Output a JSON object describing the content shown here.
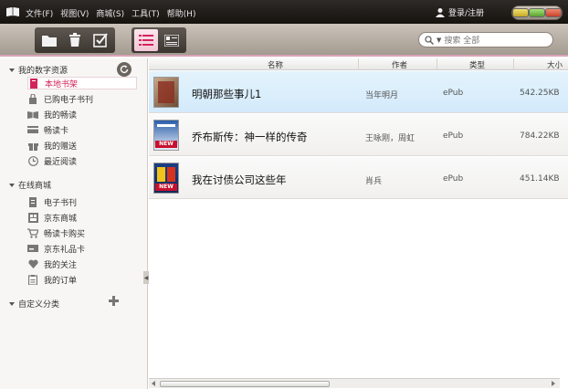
{
  "menu": [
    "文件(F)",
    "视图(V)",
    "商城(S)",
    "工具(T)",
    "帮助(H)"
  ],
  "login_label": "登录/注册",
  "search": {
    "placeholder": "搜索 全部"
  },
  "sidebar": {
    "sections": [
      {
        "label": "我的数字资源",
        "items": [
          "本地书架",
          "已购电子书刊",
          "我的畅读",
          "畅读卡",
          "我的赠送",
          "最近阅读"
        ]
      },
      {
        "label": "在线商城",
        "items": [
          "电子书刊",
          "京东商城",
          "畅读卡购买",
          "京东礼品卡",
          "我的关注",
          "我的订单"
        ]
      },
      {
        "label": "自定义分类",
        "items": []
      }
    ],
    "selected": "本地书架"
  },
  "table": {
    "columns": [
      "名称",
      "作者",
      "类型",
      "大小"
    ],
    "rows": [
      {
        "title": "明朝那些事儿1",
        "author": "当年明月",
        "type": "ePub",
        "size": "542.25KB",
        "cover_badge": ""
      },
      {
        "title": "乔布斯传：神一样的传奇",
        "author": "王咏刚，周虹",
        "type": "ePub",
        "size": "784.22KB",
        "cover_badge": "NEW"
      },
      {
        "title": "我在讨债公司这些年",
        "author": "肖兵",
        "type": "ePub",
        "size": "451.14KB",
        "cover_badge": "NEW"
      }
    ]
  },
  "colors": {
    "accent": "#d2245a",
    "selected_row": "#d9edfb",
    "titlebar": "#1e1a17"
  },
  "icons": [
    "book-logo-icon",
    "folder-icon",
    "trash-icon",
    "checkbox-icon",
    "list-view-icon",
    "shelf-view-icon",
    "search-icon",
    "user-icon",
    "refresh-icon",
    "plus-icon"
  ]
}
